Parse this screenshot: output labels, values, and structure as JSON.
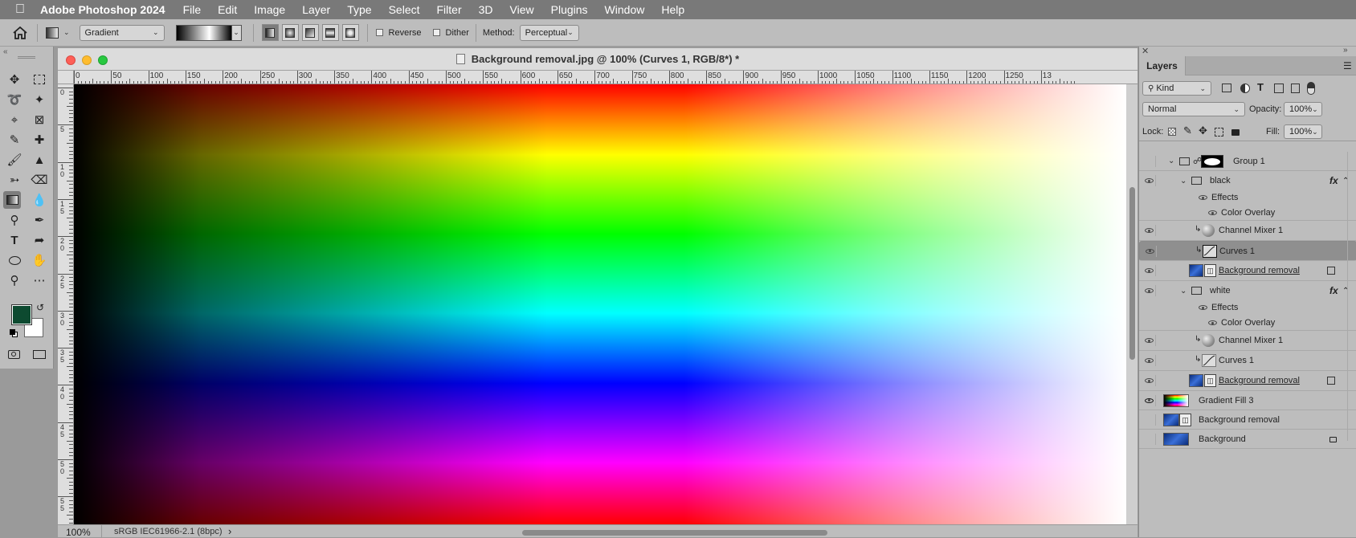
{
  "menubar": {
    "app_name": "Adobe Photoshop 2024",
    "items": [
      "File",
      "Edit",
      "Image",
      "Layer",
      "Type",
      "Select",
      "Filter",
      "3D",
      "View",
      "Plugins",
      "Window",
      "Help"
    ]
  },
  "options": {
    "gradient_preset": "Gradient",
    "reverse_label": "Reverse",
    "dither_label": "Dither",
    "method_label": "Method:",
    "method_value": "Perceptual"
  },
  "document": {
    "title": "Background removal.jpg @ 100% (Curves 1, RGB/8*) *",
    "zoom": "100%",
    "profile": "sRGB IEC61966-2.1 (8bpc)",
    "status_arrow": "›",
    "ruler_h": [
      "0",
      "50",
      "100",
      "150",
      "200",
      "250",
      "300",
      "350",
      "400",
      "450",
      "500",
      "550",
      "600",
      "650",
      "700",
      "750",
      "800",
      "850",
      "900",
      "950",
      "1000",
      "1050",
      "1100",
      "1150",
      "1200",
      "1250",
      "13"
    ],
    "ruler_v": [
      "0",
      "5",
      "1 0",
      "1 5",
      "2 0",
      "2 5",
      "3 0",
      "3 5",
      "4 0",
      "4 5",
      "5 0",
      "5 5"
    ]
  },
  "colors": {
    "foreground": "#0d4a30",
    "background": "#ffffff"
  },
  "layers_panel": {
    "tab": "Layers",
    "kind_label": "Kind",
    "blend_mode": "Normal",
    "opacity_label": "Opacity:",
    "opacity_value": "100%",
    "lock_label": "Lock:",
    "fill_label": "Fill:",
    "fill_value": "100%",
    "layers": [
      {
        "name": "Group 1",
        "visible": false
      },
      {
        "name": "black",
        "visible": true,
        "fx": "fx"
      },
      {
        "name": "Effects"
      },
      {
        "name": "Color Overlay"
      },
      {
        "name": "Channel Mixer 1",
        "visible": true
      },
      {
        "name": "Curves 1",
        "visible": true,
        "selected": true
      },
      {
        "name": "Background removal",
        "visible": true
      },
      {
        "name": "white",
        "visible": true,
        "fx": "fx"
      },
      {
        "name": "Effects"
      },
      {
        "name": "Color Overlay"
      },
      {
        "name": "Channel Mixer 1",
        "visible": true
      },
      {
        "name": "Curves 1",
        "visible": true
      },
      {
        "name": "Background removal",
        "visible": true
      },
      {
        "name": "Gradient Fill 3",
        "visible": true
      },
      {
        "name": "Background removal",
        "visible": false
      },
      {
        "name": "Background",
        "visible": false
      }
    ]
  }
}
